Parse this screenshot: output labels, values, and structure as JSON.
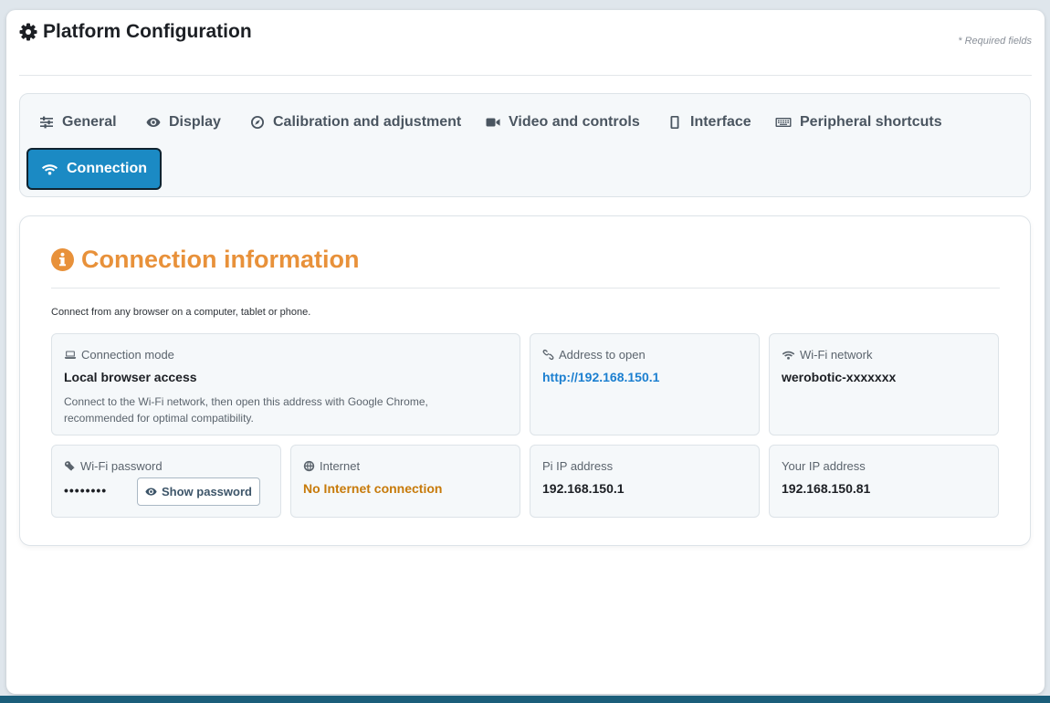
{
  "header": {
    "title": "Platform Configuration",
    "required_note": "* Required fields"
  },
  "tabs": [
    {
      "label": "General",
      "icon": "sliders-icon"
    },
    {
      "label": "Display",
      "icon": "eye-icon"
    },
    {
      "label": "Calibration and adjustment",
      "icon": "compass-icon"
    },
    {
      "label": "Video and controls",
      "icon": "video-camera-icon"
    },
    {
      "label": "Interface",
      "icon": "mobile-icon"
    },
    {
      "label": "Peripheral shortcuts",
      "icon": "keyboard-icon"
    },
    {
      "label": "Connection",
      "icon": "wifi-icon",
      "active": true
    }
  ],
  "connection": {
    "title": "Connection information",
    "description": "Connect from any browser on a computer, tablet or phone.",
    "mode": {
      "label": "Connection mode",
      "value": "Local browser access",
      "hint": "Connect to the Wi-Fi network, then open this address with Google Chrome, recommended for optimal compatibility."
    },
    "address": {
      "label": "Address to open",
      "value": "http://192.168.150.1"
    },
    "wifi_network": {
      "label": "Wi-Fi network",
      "value": "werobotic-xxxxxxx"
    },
    "wifi_password": {
      "label": "Wi-Fi password",
      "value": "••••••••",
      "show_label": "Show password"
    },
    "internet": {
      "label": "Internet",
      "value": "No Internet connection"
    },
    "pi_ip": {
      "label": "Pi IP address",
      "value": "192.168.150.1"
    },
    "your_ip": {
      "label": "Your IP address",
      "value": "192.168.150.81"
    }
  },
  "colors": {
    "accent": "#1b8ac4",
    "section_title": "#e8913a",
    "link": "#1b7fd0",
    "warning": "#c77a0a"
  }
}
